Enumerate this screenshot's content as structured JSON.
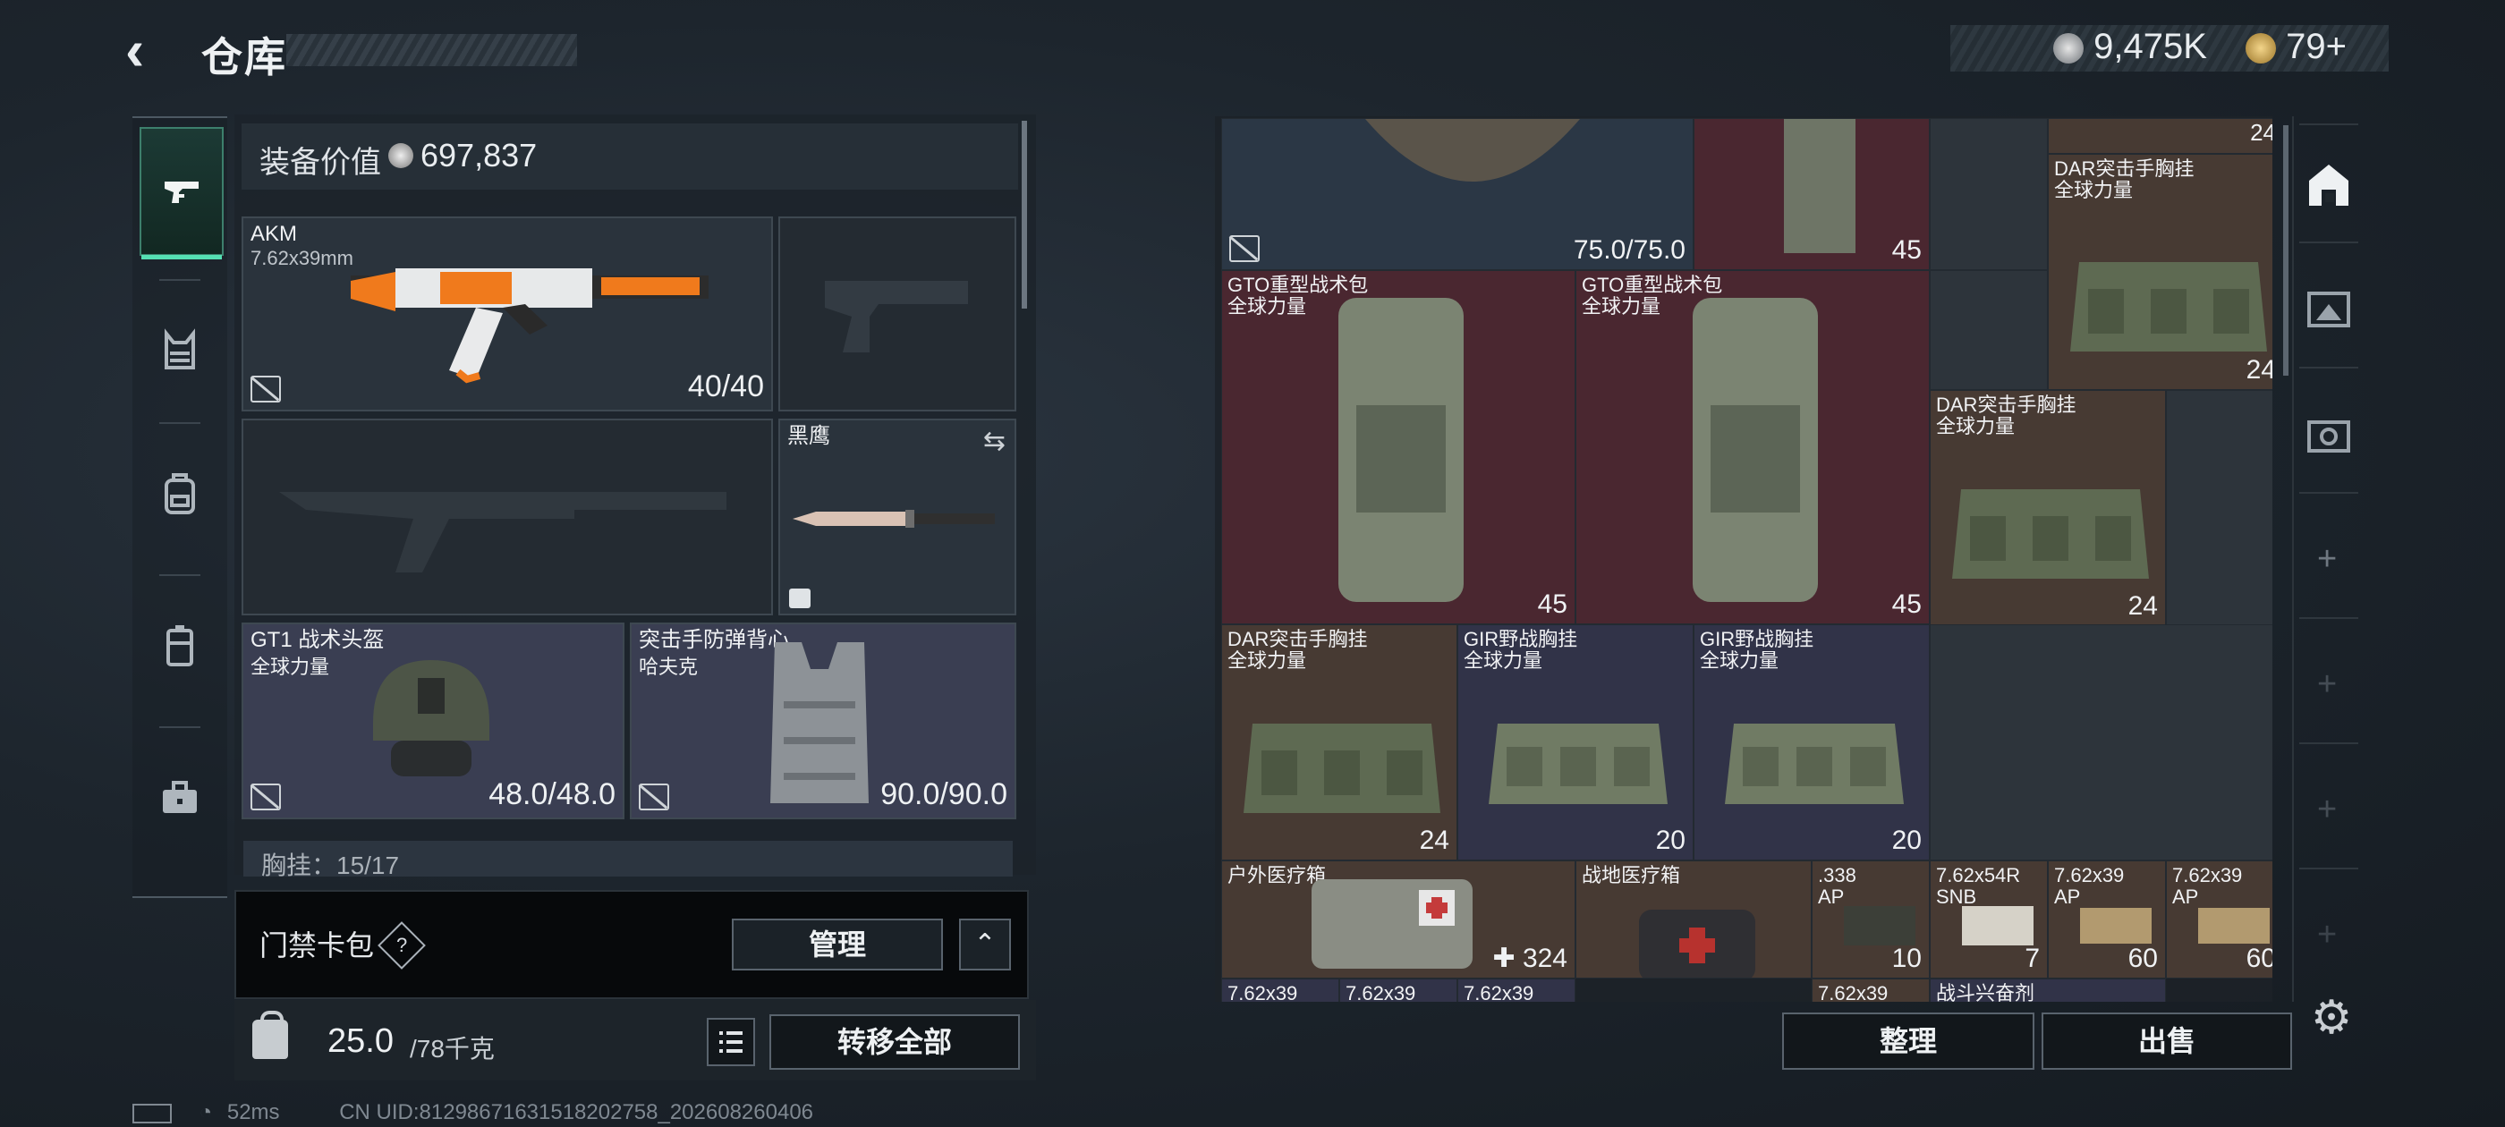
{
  "header": {
    "back_icon": "back-arrow-icon",
    "title": "仓库",
    "currency1": "9,475K",
    "currency2": "79+"
  },
  "left_tabs": [
    {
      "icon": "pistol-icon",
      "selected": true
    },
    {
      "icon": "chest-rig-icon",
      "selected": false
    },
    {
      "icon": "backpack-icon",
      "selected": false
    },
    {
      "icon": "container-icon",
      "selected": false
    },
    {
      "icon": "briefcase-icon",
      "selected": false
    }
  ],
  "equipment": {
    "value_label": "装备价值",
    "value": "697,837",
    "primary_weapon": {
      "name": "AKM",
      "caliber": "7.62x39mm",
      "durability": "40/40"
    },
    "melee": {
      "name": "黑鹰"
    },
    "helmet": {
      "name": "GT1 战术头盔",
      "maker": "全球力量",
      "durability": "48.0/48.0"
    },
    "armor": {
      "name": "突击手防弹背心",
      "maker": "哈夫克",
      "durability": "90.0/90.0"
    },
    "chest_rig_label": "胸挂：15/17"
  },
  "card_pack": {
    "label": "门禁卡包",
    "help": "?",
    "manage_label": "管理",
    "collapse_icon": "chevron-up-icon"
  },
  "weight": {
    "current": "25.0",
    "max": "/78千克",
    "transfer_label": "转移全部"
  },
  "status": {
    "ping": "52ms",
    "uid": "CN UID:8129867163151820275​8_202608260406"
  },
  "stash": {
    "items": [
      {
        "id": "top-left",
        "name": "",
        "count": "75.0/75.0"
      },
      {
        "id": "top-mid",
        "name": "",
        "count": "45"
      },
      {
        "id": "top-right",
        "name": "",
        "count": "24"
      },
      {
        "id": "dar1",
        "name": "DAR突击手胸挂\n全球力量",
        "count": "24"
      },
      {
        "id": "gto1",
        "name": "GTO重型战术包\n全球力量",
        "count": "45"
      },
      {
        "id": "gto2",
        "name": "GTO重型战术包\n全球力量",
        "count": "45"
      },
      {
        "id": "dar2",
        "name": "DAR突击手胸挂\n全球力量",
        "count": "24"
      },
      {
        "id": "dar3",
        "name": "DAR突击手胸挂\n全球力量",
        "count": "24"
      },
      {
        "id": "gir1",
        "name": "GIR野战胸挂\n全球力量",
        "count": "20"
      },
      {
        "id": "gir2",
        "name": "GIR野战胸挂\n全球力量",
        "count": "20"
      },
      {
        "id": "med1",
        "name": "户外医疗箱",
        "count": "324"
      },
      {
        "id": "med2",
        "name": "战地医疗箱",
        "count": ""
      },
      {
        "id": "ammo338",
        "name": ".338\nAP",
        "count": "10"
      },
      {
        "id": "ammo54",
        "name": "7.62x54R\nSNB",
        "count": "7"
      },
      {
        "id": "ammo39a",
        "name": "7.62x39\nAP",
        "count": "60"
      },
      {
        "id": "ammo39b",
        "name": "7.62x39\nAP",
        "count": "60"
      },
      {
        "id": "r1",
        "name": "7.62x39",
        "count": ""
      },
      {
        "id": "r2",
        "name": "7.62x39",
        "count": ""
      },
      {
        "id": "r3",
        "name": "7.62x39",
        "count": ""
      },
      {
        "id": "r4",
        "name": "7.62x39",
        "count": ""
      },
      {
        "id": "r5",
        "name": "战斗兴奋剂",
        "count": ""
      }
    ],
    "arrange_label": "整理",
    "sell_label": "出售",
    "settings_icon": "gear-icon"
  }
}
